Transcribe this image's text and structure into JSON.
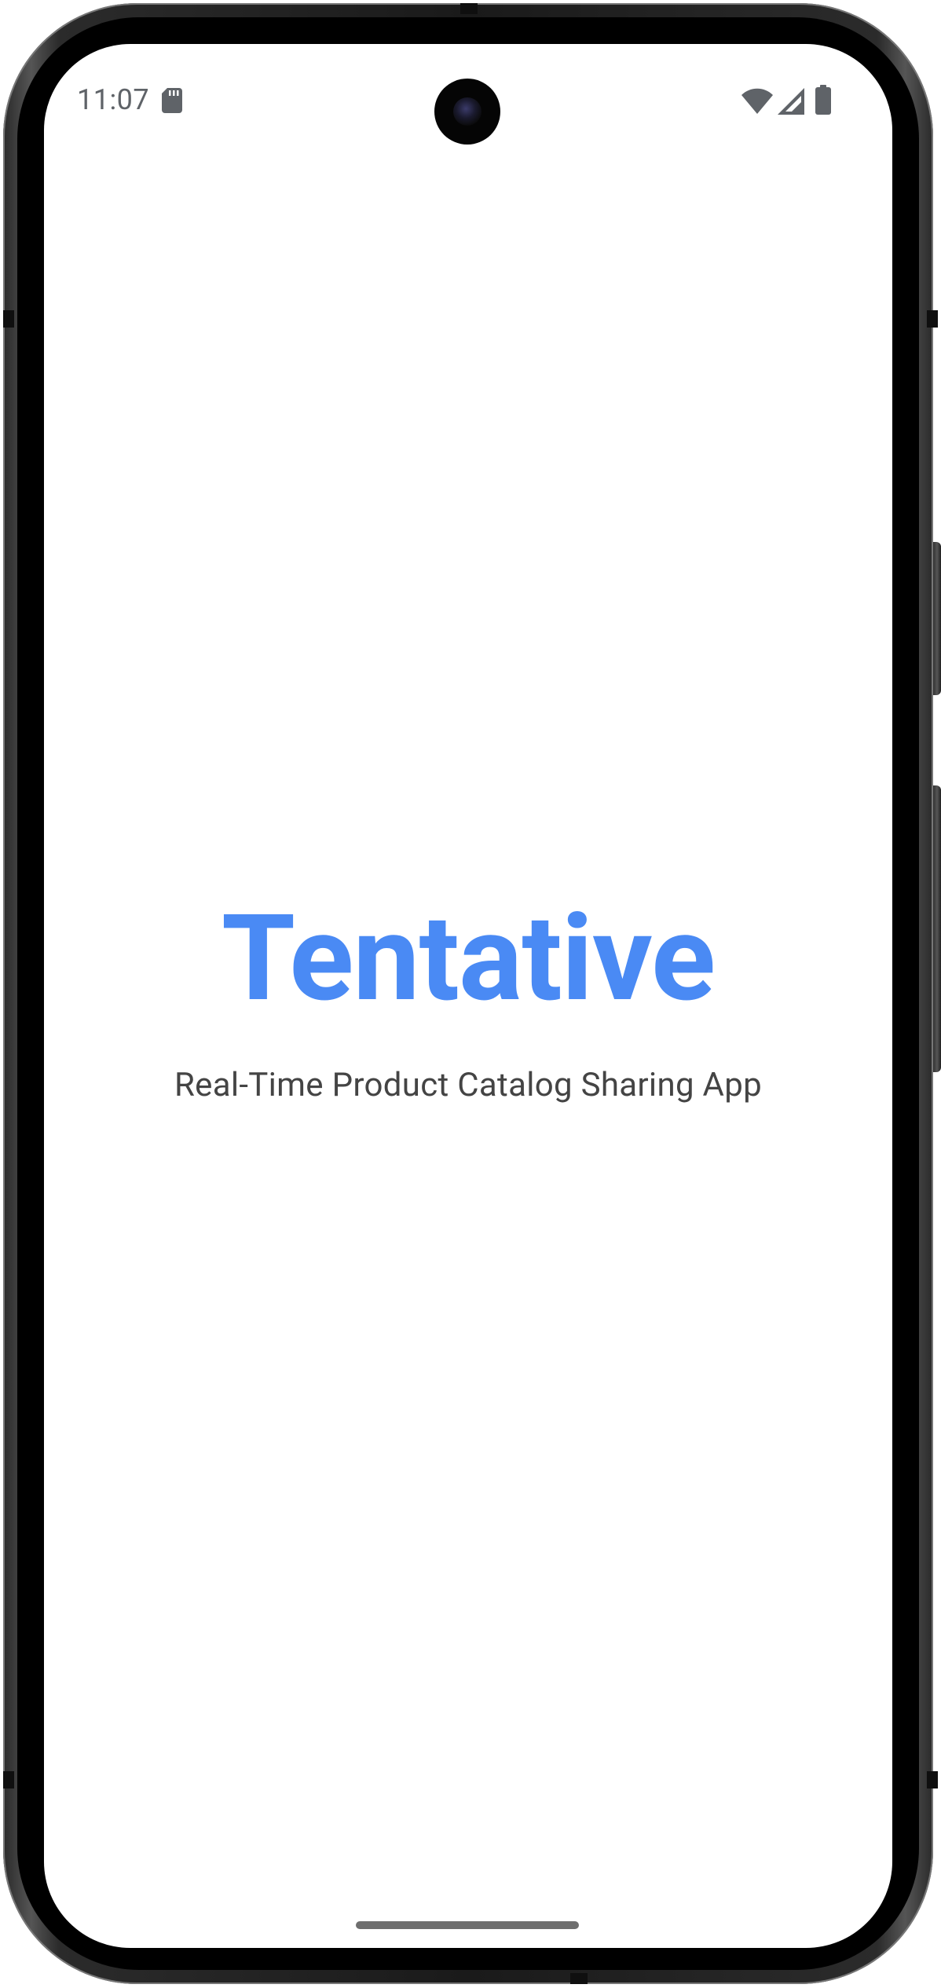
{
  "status_bar": {
    "time": "11:07",
    "icons": [
      "sd-card-icon",
      "wifi-icon",
      "cell-signal-icon",
      "battery-icon"
    ]
  },
  "splash": {
    "title": "Tentative",
    "subtitle": "Real-Time Product Catalog Sharing App"
  },
  "colors": {
    "title": "#4a8af4",
    "subtitle": "#444444",
    "background": "#ffffff",
    "status": "#5f6368"
  }
}
